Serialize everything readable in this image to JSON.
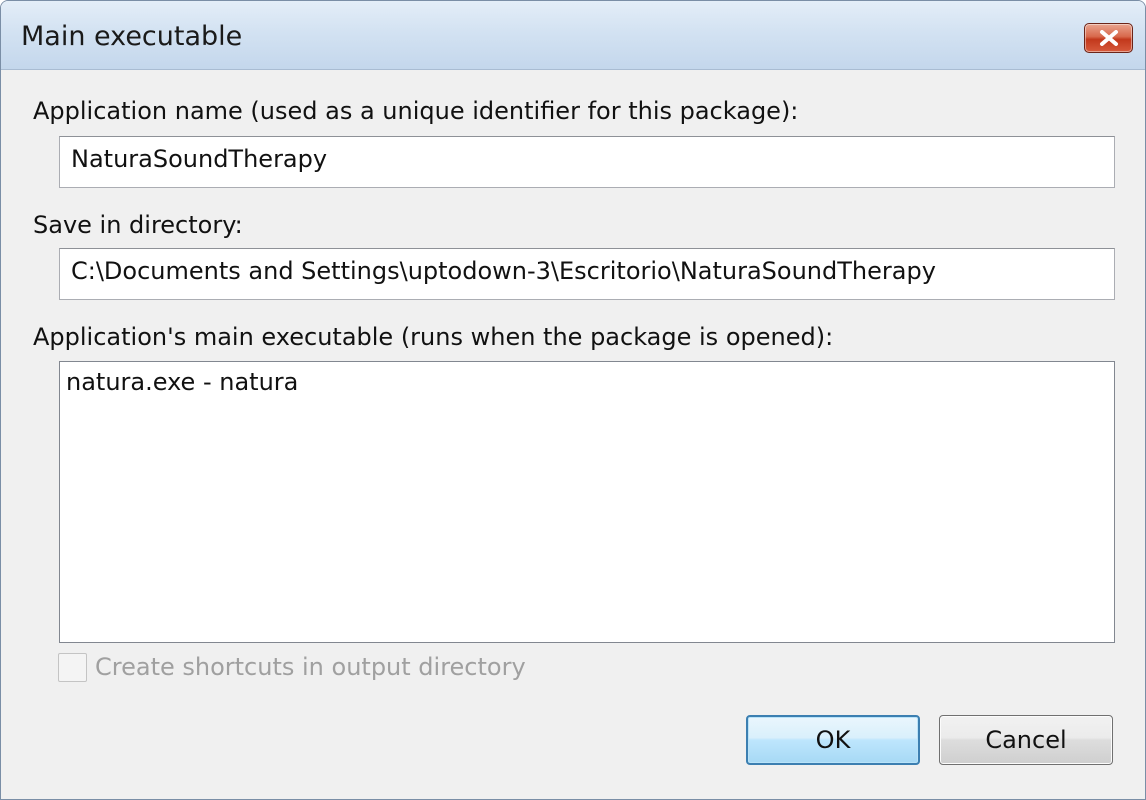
{
  "window": {
    "title": "Main executable"
  },
  "app_name": {
    "label": "Application name (used as a unique identifier for this package):",
    "value": "NaturaSoundTherapy"
  },
  "save_dir": {
    "label": "Save in directory:",
    "value": "C:\\Documents and Settings\\uptodown-3\\Escritorio\\NaturaSoundTherapy"
  },
  "main_exe": {
    "label": "Application's main executable (runs when the package is opened):",
    "items": [
      "natura.exe - natura"
    ]
  },
  "shortcuts": {
    "label": "Create shortcuts in output directory",
    "checked": false,
    "enabled": false
  },
  "buttons": {
    "ok": "OK",
    "cancel": "Cancel"
  },
  "colors": {
    "close_button": "#c2381c",
    "default_button_border": "#3c7fb1",
    "disabled_text": "#a0a0a0"
  },
  "icons": {
    "close": "close-x-icon"
  }
}
